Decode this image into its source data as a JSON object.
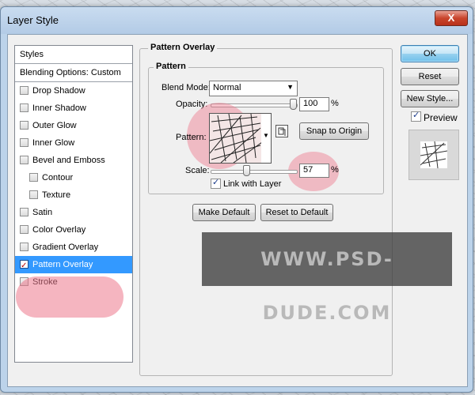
{
  "window": {
    "title": "Layer Style",
    "close_glyph": "X"
  },
  "styles_panel": {
    "header": "Styles",
    "blending_options": "Blending Options: Custom",
    "items": [
      {
        "label": "Drop Shadow",
        "checked": false,
        "sub": false
      },
      {
        "label": "Inner Shadow",
        "checked": false,
        "sub": false
      },
      {
        "label": "Outer Glow",
        "checked": false,
        "sub": false
      },
      {
        "label": "Inner Glow",
        "checked": false,
        "sub": false
      },
      {
        "label": "Bevel and Emboss",
        "checked": false,
        "sub": false
      },
      {
        "label": "Contour",
        "checked": false,
        "sub": true
      },
      {
        "label": "Texture",
        "checked": false,
        "sub": true
      },
      {
        "label": "Satin",
        "checked": false,
        "sub": false
      },
      {
        "label": "Color Overlay",
        "checked": false,
        "sub": false
      },
      {
        "label": "Gradient Overlay",
        "checked": false,
        "sub": false
      },
      {
        "label": "Pattern Overlay",
        "checked": true,
        "sub": false,
        "selected": true
      },
      {
        "label": "Stroke",
        "checked": false,
        "sub": false
      }
    ]
  },
  "pattern_overlay": {
    "group_title": "Pattern Overlay",
    "subgroup_title": "Pattern",
    "blend_mode_label": "Blend Mode:",
    "blend_mode_value": "Normal",
    "opacity_label": "Opacity:",
    "opacity_value": "100",
    "percent": "%",
    "pattern_label": "Pattern:",
    "snap_button": "Snap to Origin",
    "scale_label": "Scale:",
    "scale_value": "57",
    "link_with_layer_label": "Link with Layer",
    "link_with_layer_checked": true,
    "make_default_button": "Make Default",
    "reset_default_button": "Reset to Default",
    "opacity_percent": 100,
    "scale_percent": 57
  },
  "right_panel": {
    "ok_button": "OK",
    "reset_button": "Reset",
    "new_style_button": "New Style...",
    "preview_label": "Preview",
    "preview_checked": true
  },
  "watermark": "WWW.PSD-DUDE.COM",
  "icons": {
    "checkmark": "✓",
    "dropdown": "▼",
    "new_preset": "new-preset-icon"
  },
  "colors": {
    "selection": "#3399ff",
    "highlight": "#ed788c",
    "titlebar": "#bcd3ea"
  }
}
